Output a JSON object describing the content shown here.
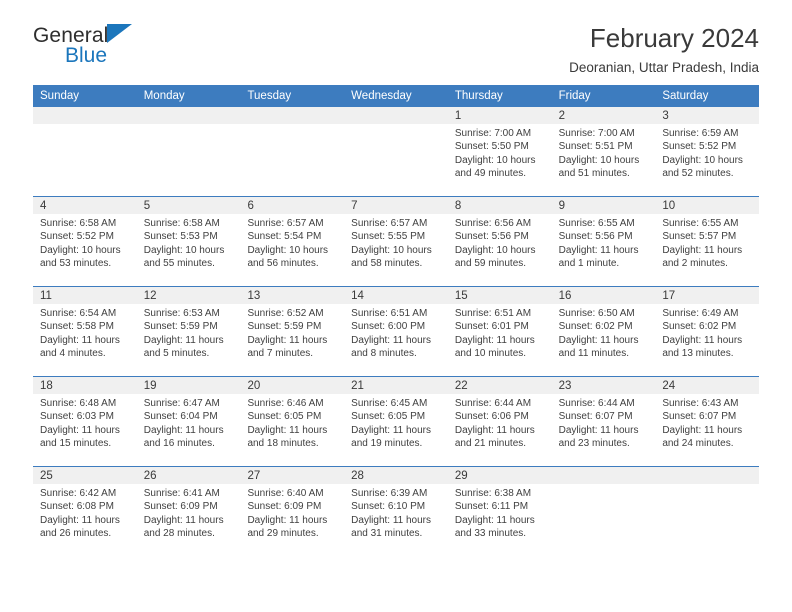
{
  "brand": {
    "name_part1": "General",
    "name_part2": "Blue",
    "accent_color": "#1b76bc"
  },
  "header": {
    "title": "February 2024",
    "subtitle": "Deoranian, Uttar Pradesh, India"
  },
  "theme": {
    "header_row_bg": "#3d7cbf",
    "daynum_band_bg": "#f0f0f0",
    "text_color": "#3f3f3f"
  },
  "calendar": {
    "weekday_headers": [
      "Sunday",
      "Monday",
      "Tuesday",
      "Wednesday",
      "Thursday",
      "Friday",
      "Saturday"
    ],
    "weeks": [
      [
        {
          "day": "",
          "lines": [
            "",
            "",
            "",
            ""
          ],
          "empty": true
        },
        {
          "day": "",
          "lines": [
            "",
            "",
            "",
            ""
          ],
          "empty": true
        },
        {
          "day": "",
          "lines": [
            "",
            "",
            "",
            ""
          ],
          "empty": true
        },
        {
          "day": "",
          "lines": [
            "",
            "",
            "",
            ""
          ],
          "empty": true
        },
        {
          "day": "1",
          "lines": [
            "Sunrise: 7:00 AM",
            "Sunset: 5:50 PM",
            "Daylight: 10 hours",
            "and 49 minutes."
          ],
          "empty": false
        },
        {
          "day": "2",
          "lines": [
            "Sunrise: 7:00 AM",
            "Sunset: 5:51 PM",
            "Daylight: 10 hours",
            "and 51 minutes."
          ],
          "empty": false
        },
        {
          "day": "3",
          "lines": [
            "Sunrise: 6:59 AM",
            "Sunset: 5:52 PM",
            "Daylight: 10 hours",
            "and 52 minutes."
          ],
          "empty": false
        }
      ],
      [
        {
          "day": "4",
          "lines": [
            "Sunrise: 6:58 AM",
            "Sunset: 5:52 PM",
            "Daylight: 10 hours",
            "and 53 minutes."
          ],
          "empty": false
        },
        {
          "day": "5",
          "lines": [
            "Sunrise: 6:58 AM",
            "Sunset: 5:53 PM",
            "Daylight: 10 hours",
            "and 55 minutes."
          ],
          "empty": false
        },
        {
          "day": "6",
          "lines": [
            "Sunrise: 6:57 AM",
            "Sunset: 5:54 PM",
            "Daylight: 10 hours",
            "and 56 minutes."
          ],
          "empty": false
        },
        {
          "day": "7",
          "lines": [
            "Sunrise: 6:57 AM",
            "Sunset: 5:55 PM",
            "Daylight: 10 hours",
            "and 58 minutes."
          ],
          "empty": false
        },
        {
          "day": "8",
          "lines": [
            "Sunrise: 6:56 AM",
            "Sunset: 5:56 PM",
            "Daylight: 10 hours",
            "and 59 minutes."
          ],
          "empty": false
        },
        {
          "day": "9",
          "lines": [
            "Sunrise: 6:55 AM",
            "Sunset: 5:56 PM",
            "Daylight: 11 hours",
            "and 1 minute."
          ],
          "empty": false
        },
        {
          "day": "10",
          "lines": [
            "Sunrise: 6:55 AM",
            "Sunset: 5:57 PM",
            "Daylight: 11 hours",
            "and 2 minutes."
          ],
          "empty": false
        }
      ],
      [
        {
          "day": "11",
          "lines": [
            "Sunrise: 6:54 AM",
            "Sunset: 5:58 PM",
            "Daylight: 11 hours",
            "and 4 minutes."
          ],
          "empty": false
        },
        {
          "day": "12",
          "lines": [
            "Sunrise: 6:53 AM",
            "Sunset: 5:59 PM",
            "Daylight: 11 hours",
            "and 5 minutes."
          ],
          "empty": false
        },
        {
          "day": "13",
          "lines": [
            "Sunrise: 6:52 AM",
            "Sunset: 5:59 PM",
            "Daylight: 11 hours",
            "and 7 minutes."
          ],
          "empty": false
        },
        {
          "day": "14",
          "lines": [
            "Sunrise: 6:51 AM",
            "Sunset: 6:00 PM",
            "Daylight: 11 hours",
            "and 8 minutes."
          ],
          "empty": false
        },
        {
          "day": "15",
          "lines": [
            "Sunrise: 6:51 AM",
            "Sunset: 6:01 PM",
            "Daylight: 11 hours",
            "and 10 minutes."
          ],
          "empty": false
        },
        {
          "day": "16",
          "lines": [
            "Sunrise: 6:50 AM",
            "Sunset: 6:02 PM",
            "Daylight: 11 hours",
            "and 11 minutes."
          ],
          "empty": false
        },
        {
          "day": "17",
          "lines": [
            "Sunrise: 6:49 AM",
            "Sunset: 6:02 PM",
            "Daylight: 11 hours",
            "and 13 minutes."
          ],
          "empty": false
        }
      ],
      [
        {
          "day": "18",
          "lines": [
            "Sunrise: 6:48 AM",
            "Sunset: 6:03 PM",
            "Daylight: 11 hours",
            "and 15 minutes."
          ],
          "empty": false
        },
        {
          "day": "19",
          "lines": [
            "Sunrise: 6:47 AM",
            "Sunset: 6:04 PM",
            "Daylight: 11 hours",
            "and 16 minutes."
          ],
          "empty": false
        },
        {
          "day": "20",
          "lines": [
            "Sunrise: 6:46 AM",
            "Sunset: 6:05 PM",
            "Daylight: 11 hours",
            "and 18 minutes."
          ],
          "empty": false
        },
        {
          "day": "21",
          "lines": [
            "Sunrise: 6:45 AM",
            "Sunset: 6:05 PM",
            "Daylight: 11 hours",
            "and 19 minutes."
          ],
          "empty": false
        },
        {
          "day": "22",
          "lines": [
            "Sunrise: 6:44 AM",
            "Sunset: 6:06 PM",
            "Daylight: 11 hours",
            "and 21 minutes."
          ],
          "empty": false
        },
        {
          "day": "23",
          "lines": [
            "Sunrise: 6:44 AM",
            "Sunset: 6:07 PM",
            "Daylight: 11 hours",
            "and 23 minutes."
          ],
          "empty": false
        },
        {
          "day": "24",
          "lines": [
            "Sunrise: 6:43 AM",
            "Sunset: 6:07 PM",
            "Daylight: 11 hours",
            "and 24 minutes."
          ],
          "empty": false
        }
      ],
      [
        {
          "day": "25",
          "lines": [
            "Sunrise: 6:42 AM",
            "Sunset: 6:08 PM",
            "Daylight: 11 hours",
            "and 26 minutes."
          ],
          "empty": false
        },
        {
          "day": "26",
          "lines": [
            "Sunrise: 6:41 AM",
            "Sunset: 6:09 PM",
            "Daylight: 11 hours",
            "and 28 minutes."
          ],
          "empty": false
        },
        {
          "day": "27",
          "lines": [
            "Sunrise: 6:40 AM",
            "Sunset: 6:09 PM",
            "Daylight: 11 hours",
            "and 29 minutes."
          ],
          "empty": false
        },
        {
          "day": "28",
          "lines": [
            "Sunrise: 6:39 AM",
            "Sunset: 6:10 PM",
            "Daylight: 11 hours",
            "and 31 minutes."
          ],
          "empty": false
        },
        {
          "day": "29",
          "lines": [
            "Sunrise: 6:38 AM",
            "Sunset: 6:11 PM",
            "Daylight: 11 hours",
            "and 33 minutes."
          ],
          "empty": false
        },
        {
          "day": "",
          "lines": [
            "",
            "",
            "",
            ""
          ],
          "empty": true
        },
        {
          "day": "",
          "lines": [
            "",
            "",
            "",
            ""
          ],
          "empty": true
        }
      ]
    ]
  }
}
